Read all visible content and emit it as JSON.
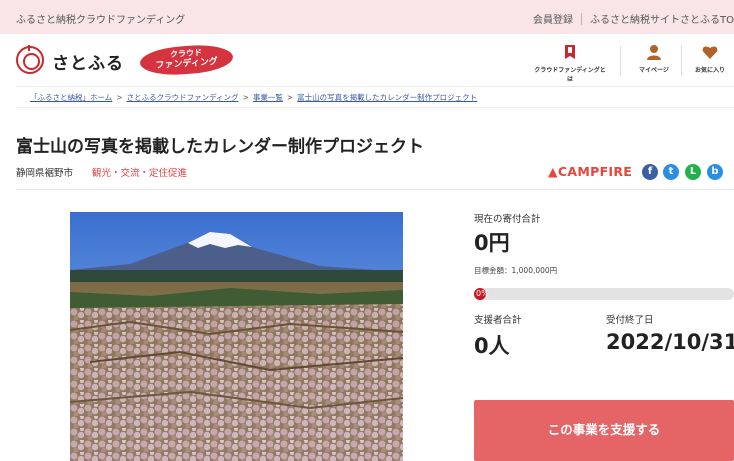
{
  "topbar": {
    "site_name": "ふるさと納税クラウドファンディング",
    "links": [
      "会員登録",
      "ふるさと納税サイトさとふるTO"
    ]
  },
  "header": {
    "logo_text": "さとふる",
    "badge_line1": "クラウド",
    "badge_line2": "ファンディング",
    "nav": [
      {
        "label": "クラウドファンディングとは",
        "icon": "book-icon"
      },
      {
        "label": "マイページ",
        "icon": "user-icon"
      },
      {
        "label": "お気に入り",
        "icon": "heart-icon"
      }
    ]
  },
  "breadcrumb": [
    "「ふるさと納税」ホーム",
    "さとふるクラウドファンディング",
    "事業一覧",
    "富士山の写真を掲載したカレンダー制作プロジェクト"
  ],
  "project": {
    "title": "富士山の写真を掲載したカレンダー制作プロジェクト",
    "location": "静岡県裾野市",
    "category": "観光・交流・定住促進",
    "platform": "CAMPFIRE"
  },
  "stats": {
    "current_label": "現在の寄付合計",
    "current_value": "0円",
    "goal_text": "目標金額：1,000,000円",
    "progress_text": "0%",
    "progress_fraction": 0,
    "supporters_label": "支援者合計",
    "supporters_value": "0人",
    "end_label": "受付終了日",
    "end_value": "2022/10/31"
  },
  "cta": {
    "support_label": "この事業を支援する"
  },
  "colors": {
    "accent": "#d5333f",
    "topbar_bg": "#f9e5e6",
    "cta_bg": "#e56567",
    "link": "#3a5aa8"
  }
}
